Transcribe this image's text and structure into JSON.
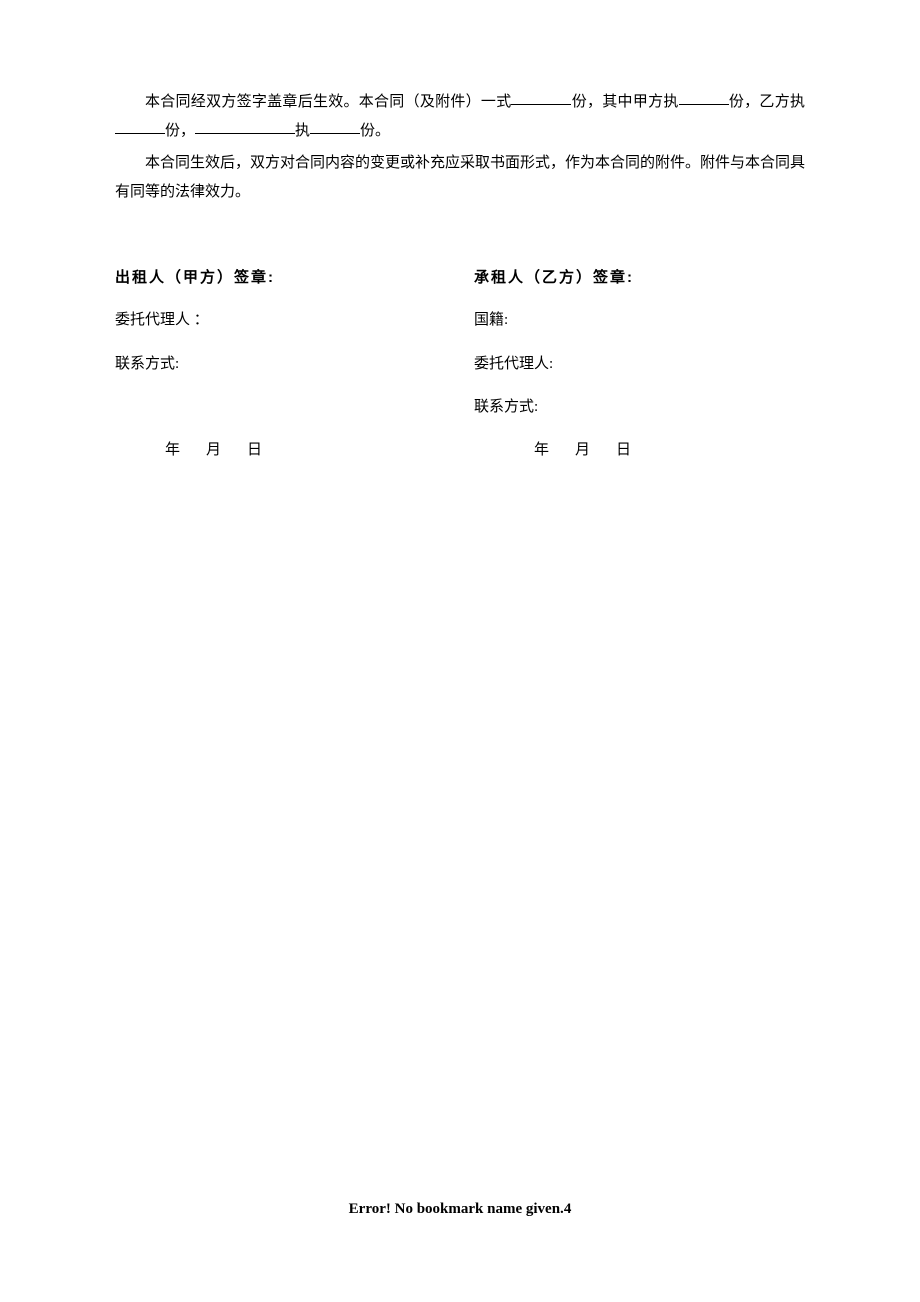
{
  "para1": {
    "seg1": "本合同经双方签字盖章后生效。本合同（及附件）一式",
    "seg2": "份，其中甲方执",
    "seg3": "份，乙方执",
    "seg4": "份，",
    "seg5": "执",
    "seg6": "份。"
  },
  "para2": "本合同生效后，双方对合同内容的变更或补充应采取书面形式，作为本合同的附件。附件与本合同具有同等的法律效力。",
  "left": {
    "heading": "出租人（甲方）签章:",
    "agent": "委托代理人 ：",
    "contact": "联系方式:",
    "y": "年",
    "m": "月",
    "d": "日"
  },
  "right": {
    "heading": "承租人（乙方）签章:",
    "nationality": "国籍:",
    "agent": "委托代理人:",
    "contact": "联系方式:",
    "y": "年",
    "m": "月",
    "d": "日"
  },
  "footer": {
    "error": "Error! No bookmark name given.",
    "page": "4"
  }
}
